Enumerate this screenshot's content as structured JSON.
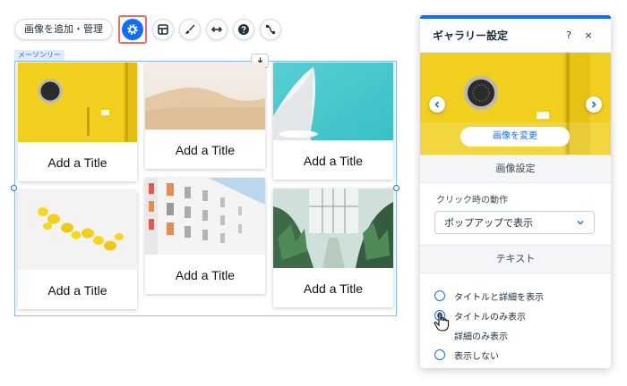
{
  "toolbar": {
    "add_manage_label": "画像を追加・管理",
    "icons": [
      "settings-icon",
      "layout-icon",
      "design-brush-icon",
      "stretch-icon",
      "help-icon",
      "connect-icon"
    ]
  },
  "gallery": {
    "label": "メーソンリー",
    "items": [
      {
        "title": "Add a Title",
        "image": "yellow-door"
      },
      {
        "title": "Add a Title",
        "image": "desert-dunes"
      },
      {
        "title": "Add a Title",
        "image": "white-architecture"
      },
      {
        "title": "Add a Title",
        "image": "lemons"
      },
      {
        "title": "Add a Title",
        "image": "colorful-building"
      },
      {
        "title": "Add a Title",
        "image": "greenhouse"
      }
    ]
  },
  "panel": {
    "title": "ギャラリー設定",
    "help": "?",
    "close": "×",
    "change_image_label": "画像を変更",
    "image_settings_heading": "画像設定",
    "click_action_label": "クリック時の動作",
    "click_action_value": "ポップアップで表示",
    "text_heading": "テキスト",
    "text_options": [
      {
        "label": "タイトルと詳細を表示",
        "selected": false
      },
      {
        "label": "タイトルのみ表示",
        "selected": true
      },
      {
        "label": "詳細のみ表示",
        "selected": false
      },
      {
        "label": "表示しない",
        "selected": false
      }
    ]
  },
  "colors": {
    "accent": "#116dff",
    "highlight": "#f06a5d",
    "door_yellow": "#f2d021"
  }
}
